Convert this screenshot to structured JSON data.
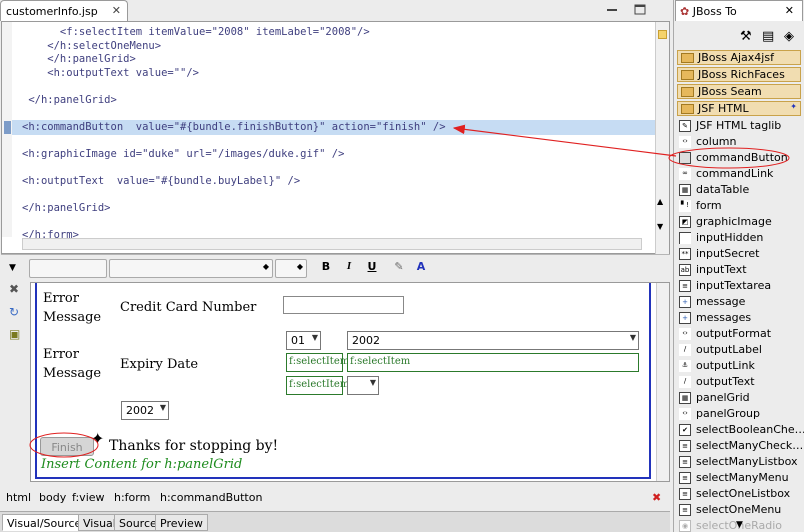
{
  "editor": {
    "tab_label": "customerInfo.jsp",
    "close_glyph": "✕",
    "source_lines": [
      "      <f:selectItem itemValue=\"2008\" itemLabel=\"2008\"/>",
      "    </h:selectOneMenu>",
      "    </h:panelGrid>",
      "    <h:outputText value=\"\"/>",
      "",
      " </h:panelGrid>",
      "",
      "<h:commandButton  value=\"#{bundle.finishButton}\" action=\"finish\" />",
      "",
      "<h:graphicImage id=\"duke\" url=\"/images/duke.gif\" />",
      "",
      "<h:outputText  value=\"#{bundle.buyLabel}\" />",
      "",
      "</h:panelGrid>",
      "",
      "</h:form>"
    ]
  },
  "toolbar": {
    "bold": "B",
    "italic": "I",
    "underline": "U"
  },
  "visual": {
    "error1": "Error",
    "message1": "Message",
    "cc_label": "Credit Card Number",
    "error2": "Error",
    "message2": "Message",
    "expiry_label": "Expiry Date",
    "month_value": "01",
    "year_value": "2002",
    "select_item_a": "f:selectItem",
    "select_item_b": "f:selectItem",
    "select_item_c": "f:selectItem",
    "year2_value": "2002",
    "finish_label": "Finish",
    "thanks_text": "Thanks for stopping by!",
    "insert_hint": "Insert Content for h:panelGrid"
  },
  "breadcrumbs": [
    "html",
    "body",
    "f:view",
    "h:form",
    "h:commandButton"
  ],
  "bottom_tabs": [
    "Visual/Source",
    "Visual",
    "Source",
    "Preview"
  ],
  "palette": {
    "tab_label": "JBoss To",
    "close_glyph": "✕",
    "groups": [
      "JBoss Ajax4jsf",
      "JBoss RichFaces",
      "JBoss Seam",
      "JSF HTML"
    ],
    "items": [
      "JSF HTML taglib",
      "column",
      "commandButton",
      "commandLink",
      "dataTable",
      "form",
      "graphicImage",
      "inputHidden",
      "inputSecret",
      "inputText",
      "inputTextarea",
      "message",
      "messages",
      "outputFormat",
      "outputLabel",
      "outputLink",
      "outputText",
      "panelGrid",
      "panelGroup",
      "selectBooleanChe…",
      "selectManyCheck…",
      "selectManyListbox",
      "selectManyMenu",
      "selectOneListbox",
      "selectOneMenu",
      "selectOneRadio"
    ]
  },
  "colors": {
    "selection": "#c6dcf3",
    "annotation": "#e02020",
    "frame": "#2233bb",
    "hint": "#1e8c1e"
  }
}
